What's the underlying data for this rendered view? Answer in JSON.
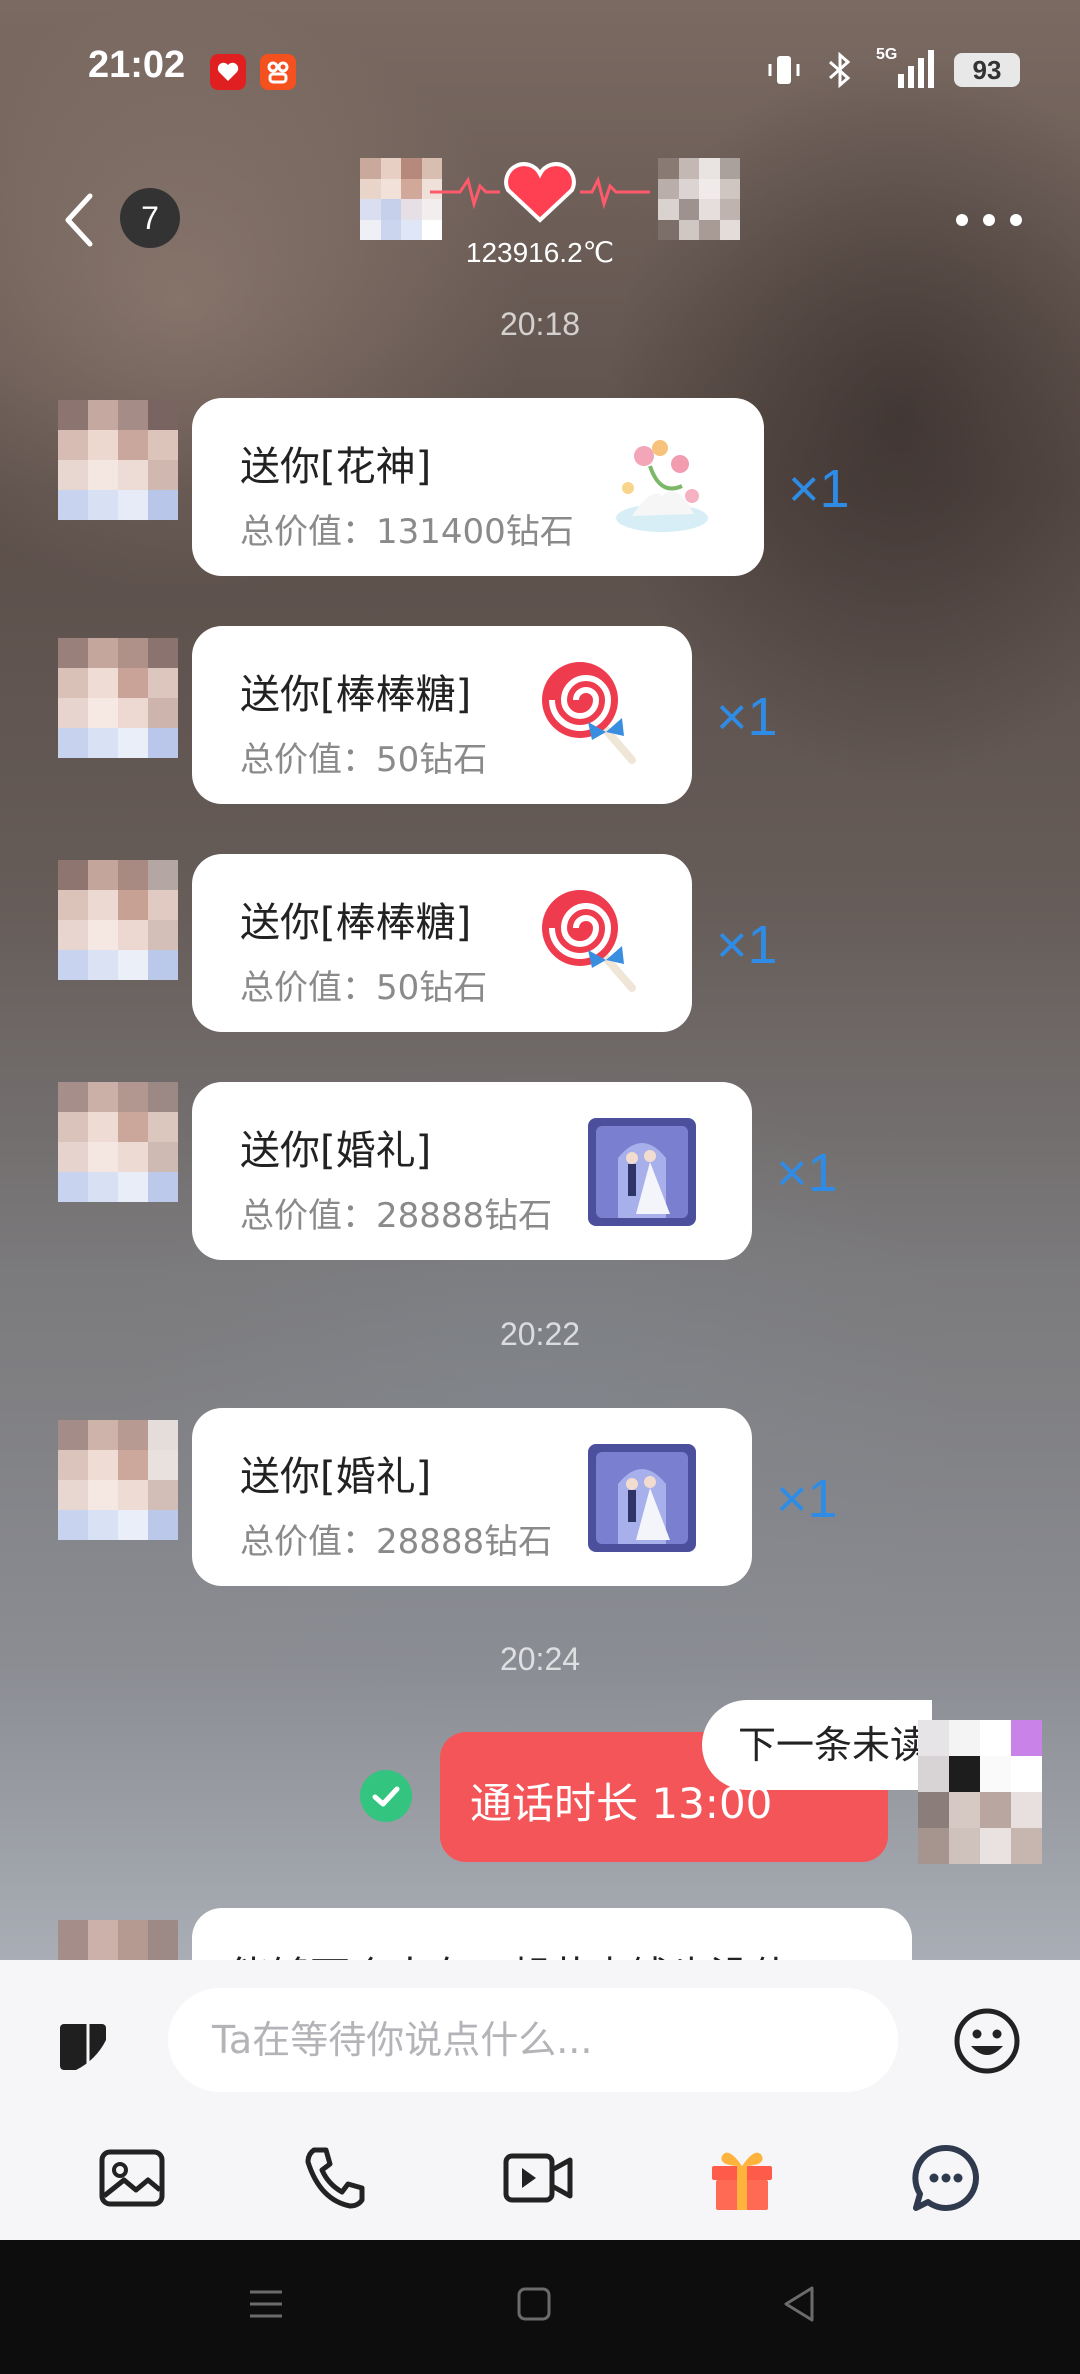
{
  "status_bar": {
    "time": "21:02",
    "network": "5G",
    "battery": "93"
  },
  "header": {
    "unread_count": "7",
    "intimacy": "123916.2℃"
  },
  "messages": [
    {
      "type": "timestamp",
      "text": "20:18"
    },
    {
      "type": "gift",
      "title": "送你[花神]",
      "value": "总价值：131400钻石",
      "count": "×1",
      "gift_icon": "flower-god-gift-icon"
    },
    {
      "type": "gift",
      "title": "送你[棒棒糖]",
      "value": "总价值：50钻石",
      "count": "×1",
      "gift_icon": "lollipop-gift-icon"
    },
    {
      "type": "gift",
      "title": "送你[棒棒糖]",
      "value": "总价值：50钻石",
      "count": "×1",
      "gift_icon": "lollipop-gift-icon"
    },
    {
      "type": "gift",
      "title": "送你[婚礼]",
      "value": "总价值：28888钻石",
      "count": "×1",
      "gift_icon": "wedding-gift-icon"
    },
    {
      "type": "timestamp",
      "text": "20:22"
    },
    {
      "type": "gift",
      "title": "送你[婚礼]",
      "value": "总价值：28888钻石",
      "count": "×1",
      "gift_icon": "wedding-gift-icon"
    },
    {
      "type": "timestamp",
      "text": "20:24"
    },
    {
      "type": "call",
      "text": "通话时长 13:00",
      "icon": "video-call-icon"
    },
    {
      "type": "text",
      "text": "能够两个人在一起花点钱也没什"
    }
  ],
  "next_unread": "下一条未读",
  "composer": {
    "placeholder": "Ta在等待你说点什么..."
  },
  "toolbar": [
    "image-icon",
    "phone-icon",
    "video-call-icon",
    "gift-icon",
    "chat-bubble-icon"
  ],
  "colors": {
    "accent_red": "#f35558",
    "multiplier_blue": "#2f8ce6",
    "check_green": "#33c47f"
  }
}
